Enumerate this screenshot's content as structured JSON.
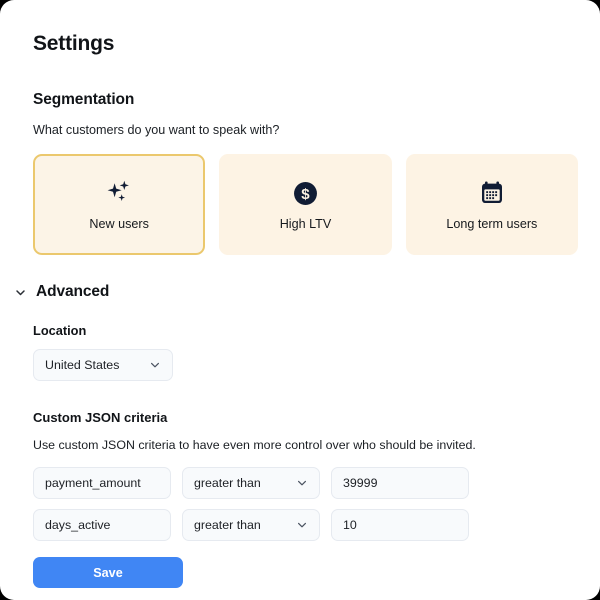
{
  "page": {
    "title": "Settings"
  },
  "segmentation": {
    "heading": "Segmentation",
    "question": "What customers do you want to speak with?",
    "cards": [
      {
        "label": "New users",
        "icon": "sparkles-icon",
        "selected": true
      },
      {
        "label": "High LTV",
        "icon": "dollar-circle-icon",
        "selected": false
      },
      {
        "label": "Long term users",
        "icon": "calendar-icon",
        "selected": false
      }
    ]
  },
  "advanced": {
    "label": "Advanced",
    "expand_icon": "chevron-down-icon",
    "location": {
      "label": "Location",
      "value": "United States",
      "options": [
        "United States"
      ]
    },
    "criteria": {
      "title": "Custom JSON criteria",
      "description": "Use custom JSON criteria to have even more control over who should be invited.",
      "rows": [
        {
          "key": "payment_amount",
          "operator": "greater than",
          "value": "39999"
        },
        {
          "key": "days_active",
          "operator": "greater than",
          "value": "10"
        }
      ],
      "operator_options": [
        "greater than"
      ]
    },
    "save_label": "Save"
  },
  "colors": {
    "card_bg": "#fdf3e4",
    "card_selected_border": "#ebc86d",
    "icon": "#111c34",
    "primary_button": "#4086f4",
    "control_bg": "#f8fafc"
  }
}
